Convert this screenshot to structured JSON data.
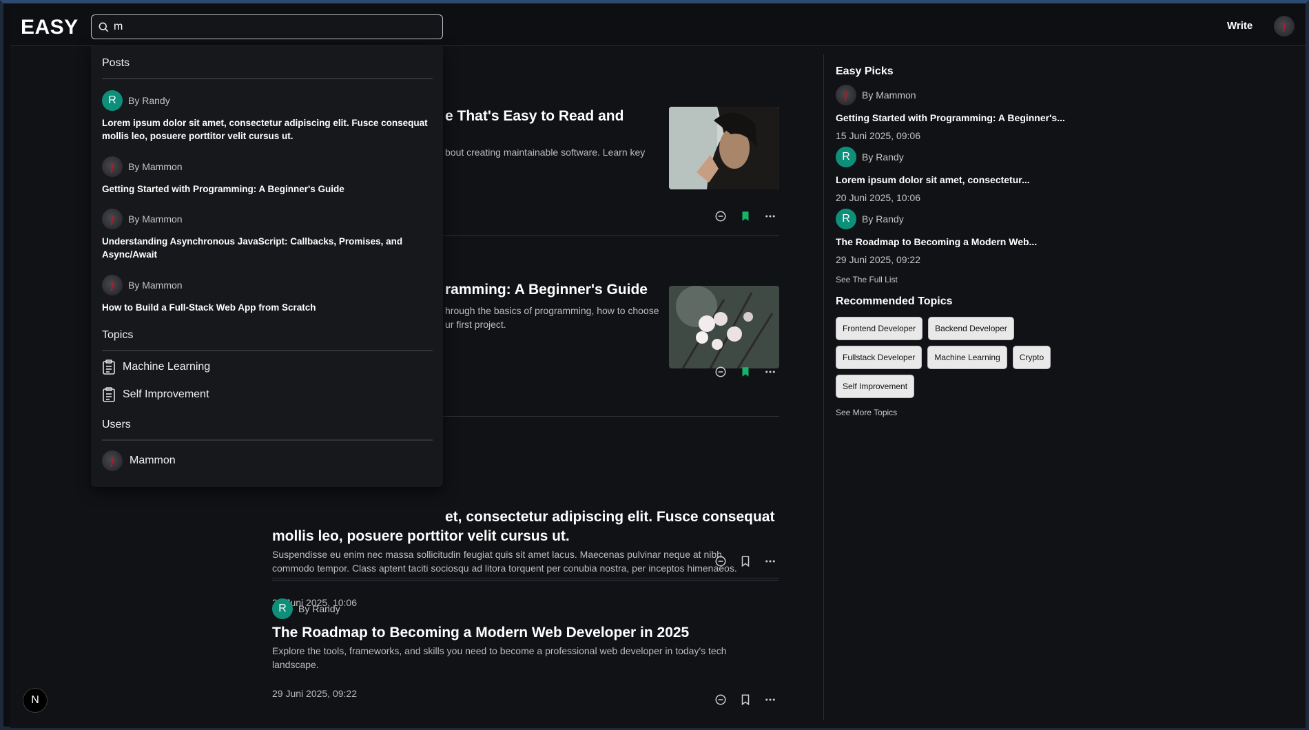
{
  "header": {
    "logo": "EASY",
    "search_value": "m",
    "write_label": "Write"
  },
  "search_results": {
    "posts_heading": "Posts",
    "posts": [
      {
        "author": "By Randy",
        "avatar_letter": "R",
        "avatar_type": "letter",
        "title": "Lorem ipsum dolor sit amet, consectetur adipiscing elit. Fusce consequat mollis leo, posuere porttitor velit cursus ut."
      },
      {
        "author": "By Mammon",
        "avatar_type": "image",
        "title": "Getting Started with Programming: A Beginner's Guide"
      },
      {
        "author": "By Mammon",
        "avatar_type": "image",
        "title": "Understanding Asynchronous JavaScript: Callbacks, Promises, and Async/Await"
      },
      {
        "author": "By Mammon",
        "avatar_type": "image",
        "title": "How to Build a Full-Stack Web App from Scratch"
      }
    ],
    "topics_heading": "Topics",
    "topics": [
      {
        "label": "Machine Learning",
        "icon": "clipboard-list-icon"
      },
      {
        "label": "Self Improvement",
        "icon": "clipboard-list-icon"
      }
    ],
    "users_heading": "Users",
    "users": [
      {
        "name": "Mammon"
      }
    ]
  },
  "feed": {
    "posts": [
      {
        "title_visible": "e That's Easy to Read and",
        "desc_visible": "bout creating maintainable software. Learn key",
        "bookmarked": true,
        "thumb": "portrait-praying-man"
      },
      {
        "title_visible": "ramming: A Beginner's Guide",
        "desc_line1": "hrough the basics of programming, how to choose",
        "desc_line2": "ur first project.",
        "bookmarked": true,
        "thumb": "white-blossoms"
      },
      {
        "title_line1": "et, consectetur adipiscing elit. Fusce consequat",
        "title_line2": "mollis leo, posuere porttitor velit cursus ut.",
        "desc": "Suspendisse eu enim nec massa sollicitudin feugiat quis sit amet lacus. Maecenas pulvinar neque at nibh commodo tempor. Class aptent taciti sociosqu ad litora torquent per conubia nostra, per inceptos himenaeos.",
        "date": "20 Juni 2025, 10:06",
        "bookmarked": false
      },
      {
        "author": "By Randy",
        "avatar_letter": "R",
        "title": "The Roadmap to Becoming a Modern Web Developer in 2025",
        "desc": "Explore the tools, frameworks, and skills you need to become a professional web developer in today's tech landscape.",
        "date": "29 Juni 2025, 09:22",
        "bookmarked": false
      }
    ]
  },
  "sidebar": {
    "picks_heading": "Easy Picks",
    "picks": [
      {
        "author": "By Mammon",
        "avatar_type": "image",
        "title": "Getting Started with Programming: A Beginner's...",
        "date": "15 Juni 2025, 09:06"
      },
      {
        "author": "By Randy",
        "avatar_type": "letter",
        "avatar_letter": "R",
        "title": "Lorem ipsum dolor sit amet, consectetur...",
        "date": "20 Juni 2025, 10:06"
      },
      {
        "author": "By Randy",
        "avatar_type": "letter",
        "avatar_letter": "R",
        "title": "The Roadmap to Becoming a Modern Web...",
        "date": "29 Juni 2025, 09:22"
      }
    ],
    "see_full_list": "See The Full List",
    "topics_heading": "Recommended Topics",
    "topics": [
      "Frontend Developer",
      "Backend Developer",
      "Fullstack Developer",
      "Machine Learning",
      "Crypto",
      "Self Improvement"
    ],
    "see_more_topics": "See More Topics"
  },
  "dev_badge": "N",
  "colors": {
    "accent_green": "#18b26a",
    "avatar_teal": "#0e8f7a",
    "background": "#111216"
  }
}
